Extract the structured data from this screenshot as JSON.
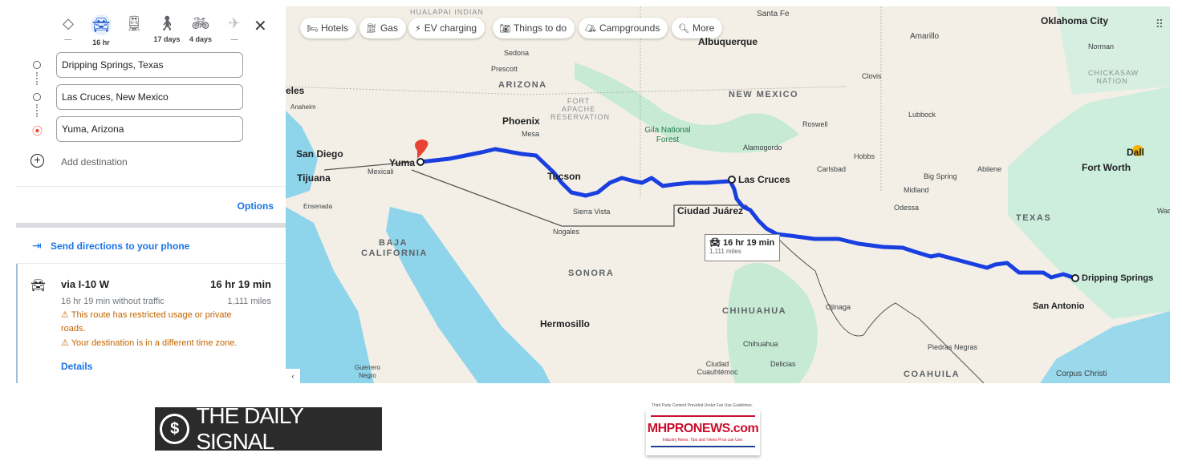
{
  "travel_modes": [
    {
      "icon": "best-route-icon",
      "label": "—"
    },
    {
      "icon": "car-icon",
      "label": "16 hr",
      "active": true
    },
    {
      "icon": "transit-icon",
      "label": ""
    },
    {
      "icon": "walking-icon",
      "label": "17 days"
    },
    {
      "icon": "bicycle-icon",
      "label": "4 days"
    },
    {
      "icon": "flight-icon",
      "label": "—"
    }
  ],
  "waypoints": [
    "Dripping Springs, Texas",
    "Las Cruces, New Mexico",
    "Yuma, Arizona"
  ],
  "add_destination": "Add destination",
  "options": "Options",
  "send_directions": "Send directions to your phone",
  "route": {
    "via": "via I-10 W",
    "duration": "16 hr 19 min",
    "no_traffic": "16 hr 19 min without traffic",
    "distance": "1,111 miles",
    "warnings": [
      "This route has restricted usage or private roads.",
      "Your destination is in a different time zone."
    ],
    "details": "Details"
  },
  "chips": [
    "Hotels",
    "Gas",
    "EV charging",
    "Things to do",
    "Campgrounds",
    "More"
  ],
  "badge": {
    "duration": "16 hr 19 min",
    "distance": "1,111 miles"
  },
  "map_labels": [
    "HUALAPAI INDIAN",
    "Santa Fe",
    "Albuquerque",
    "Amarillo",
    "Oklahoma City",
    "Norman",
    "CHICKASAW NATION",
    "Sedona",
    "Prescott",
    "ARIZONA",
    "Clovis",
    "NEW MEXICO",
    "eles",
    "Anaheim",
    "FORT APACHE RESERVATION",
    "Lubbock",
    "Phoenix",
    "Mesa",
    "Roswell",
    "Gila National Forest",
    "Alamogordo",
    "Dall",
    "Hobbs",
    "San Diego",
    "Fort Worth",
    "Yuma",
    "Abilene",
    "Carlsbad",
    "Mexicali",
    "Tijuana",
    "Tucson",
    "Las Cruces",
    "Big Spring",
    "Midland",
    "Ensenada",
    "Odessa",
    "Waco",
    "Sierra Vista",
    "Ciudad Juárez",
    "TEXAS",
    "Nogales",
    "BAJA CALIFORNIA",
    "SONORA",
    "Dripping Springs",
    "CHIHUAHUA",
    "San Antonio",
    "Ojinaga",
    "Hermosillo",
    "Chihuahua",
    "Piedras Negras",
    "Delicias",
    "Ciudad Cuauhtémoc",
    "Guerrero Negro",
    "COAHUILA",
    "Corpus Christi"
  ],
  "colors": {
    "route": "#1a3fe0",
    "link": "#1a73e8",
    "warning": "#c26401",
    "water": "#8ed4ea",
    "park": "#c6ead4"
  },
  "logos": {
    "daily_signal": "THE DAILY SIGNAL",
    "mhpronews_caption": "Third Party Content Provided Under Fair Use Guidelines.",
    "mhpronews": "MHPRONEWS.com",
    "mhpronews_tagline": "Industry News, Tips and Views Pros can Use."
  }
}
